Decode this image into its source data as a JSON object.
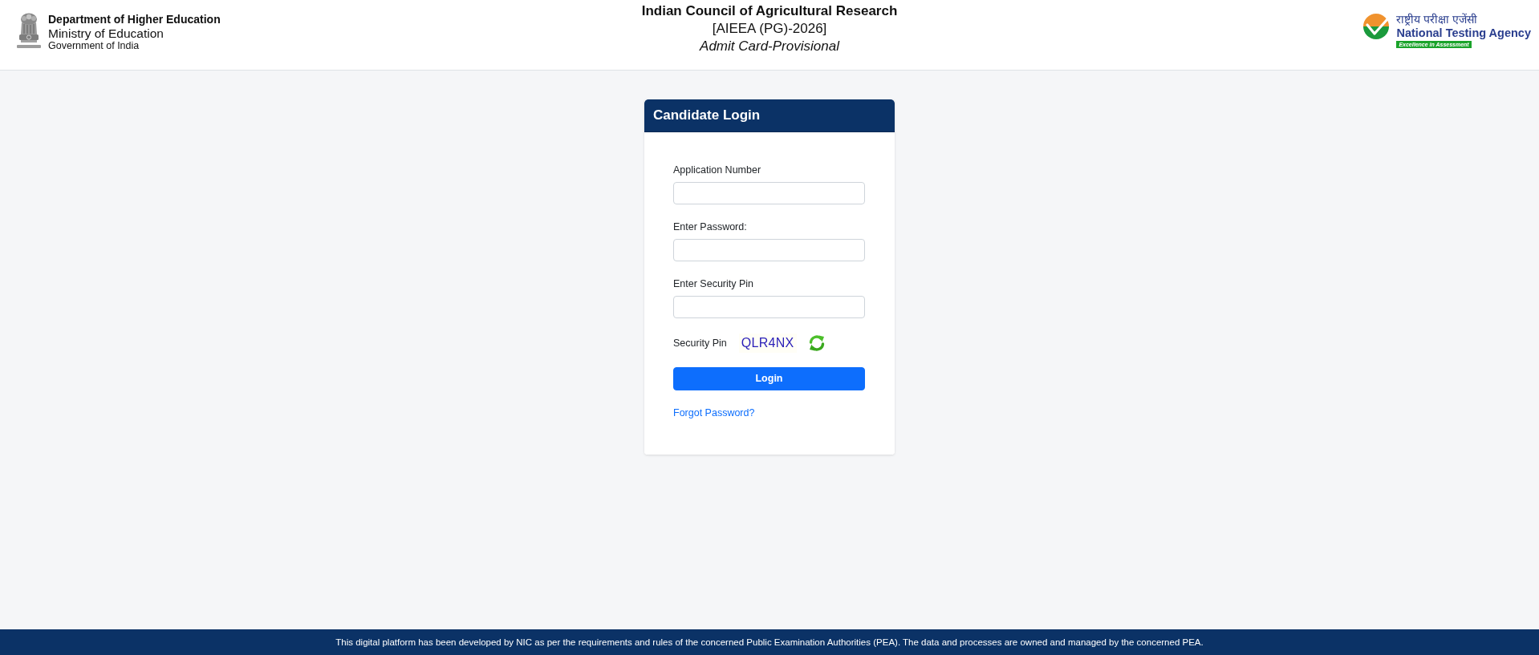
{
  "header": {
    "department": "Department of Higher Education",
    "ministry": "Ministry of Education",
    "government": "Government of India",
    "title": "Indian Council of Agricultural Research",
    "exam": "[AIEEA (PG)-2026]",
    "subtitle": "Admit Card-Provisional",
    "agency_hindi": "राष्ट्रीय परीक्षा एजेंसी",
    "agency": "National Testing Agency",
    "agency_tagline": "Excellence in Assessment"
  },
  "login": {
    "title": "Candidate Login",
    "fields": [
      {
        "label": "Application Number"
      },
      {
        "label": "Enter Password:"
      },
      {
        "label": "Enter Security Pin"
      }
    ],
    "captcha": {
      "label": "Security Pin",
      "code": "QLR4NX"
    },
    "button": "Login",
    "forgot_link": "Forgot Password?"
  },
  "footer": {
    "text": "This digital platform has been developed by NIC as per the requirements and rules of the concerned Public Examination Authorities (PEA). The data and processes are owned and managed by the concerned PEA."
  }
}
